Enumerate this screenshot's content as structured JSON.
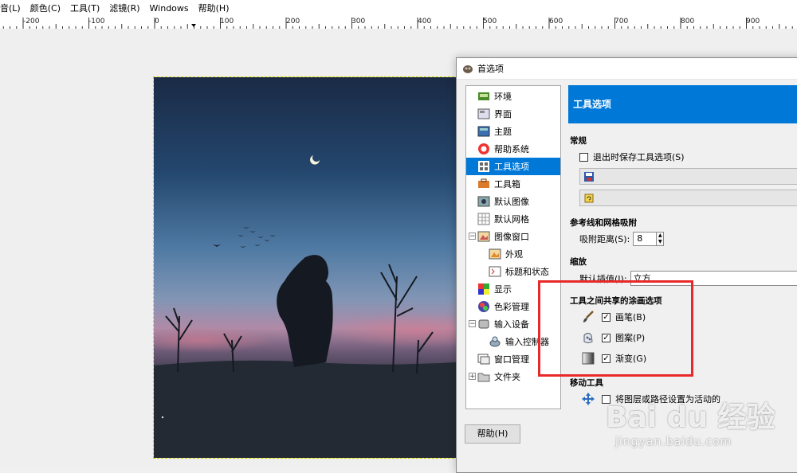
{
  "menubar": {
    "items": [
      "音(L)",
      "颜色(C)",
      "工具(T)",
      "滤镜(R)",
      "Windows",
      "帮助(H)"
    ]
  },
  "ruler": {
    "labels": [
      "-200",
      "-100",
      "0",
      "100",
      "200",
      "300",
      "400",
      "500",
      "600",
      "700",
      "800",
      "900"
    ]
  },
  "dialog": {
    "title": "首选项",
    "nav": [
      {
        "label": "环境",
        "icon": "environment-icon",
        "selected": false
      },
      {
        "label": "界面",
        "icon": "interface-icon",
        "selected": false
      },
      {
        "label": "主题",
        "icon": "theme-icon",
        "selected": false
      },
      {
        "label": "帮助系统",
        "icon": "help-system-icon",
        "selected": false
      },
      {
        "label": "工具选项",
        "icon": "tool-options-icon",
        "selected": true
      },
      {
        "label": "工具箱",
        "icon": "toolbox-icon",
        "selected": false
      },
      {
        "label": "默认图像",
        "icon": "default-image-icon",
        "selected": false
      },
      {
        "label": "默认网格",
        "icon": "default-grid-icon",
        "selected": false
      },
      {
        "label": "图像窗口",
        "icon": "image-window-icon",
        "selected": false
      },
      {
        "label": "外观",
        "icon": "appearance-icon",
        "selected": false
      },
      {
        "label": "标题和状态",
        "icon": "title-status-icon",
        "selected": false
      },
      {
        "label": "显示",
        "icon": "display-icon",
        "selected": false
      },
      {
        "label": "色彩管理",
        "icon": "color-management-icon",
        "selected": false
      },
      {
        "label": "输入设备",
        "icon": "input-devices-icon",
        "selected": false
      },
      {
        "label": "输入控制器",
        "icon": "input-controllers-icon",
        "selected": false
      },
      {
        "label": "窗口管理",
        "icon": "window-management-icon",
        "selected": false
      },
      {
        "label": "文件夹",
        "icon": "folders-icon",
        "selected": false
      }
    ],
    "help_label": "帮助(H)",
    "content": {
      "header": "工具选项",
      "general": {
        "title": "常规",
        "save_on_exit": "退出时保存工具选项(S)",
        "save_on_exit_checked": false
      },
      "guides": {
        "title": "参考线和网格吸附",
        "snap_label": "吸附距离(S):",
        "snap_value": "8"
      },
      "scaling": {
        "title": "缩放",
        "interp_label": "默认插值(I):",
        "interp_value": "立方"
      },
      "paint_options": {
        "title": "工具之间共享的涂画选项",
        "items": [
          {
            "label": "画笔(B)",
            "checked": true,
            "icon": "brush-icon"
          },
          {
            "label": "图案(P)",
            "checked": true,
            "icon": "pattern-icon"
          },
          {
            "label": "渐变(G)",
            "checked": true,
            "icon": "gradient-icon"
          }
        ]
      },
      "move_tool": {
        "title": "移动工具",
        "item": "将图层或路径设置为活动的",
        "checked": false
      }
    }
  },
  "watermark": {
    "logo": "Bai du 经验",
    "url": "jingyan.baidu.com"
  },
  "colors": {
    "accent": "#0078d7",
    "highlight": "#e8292a"
  }
}
